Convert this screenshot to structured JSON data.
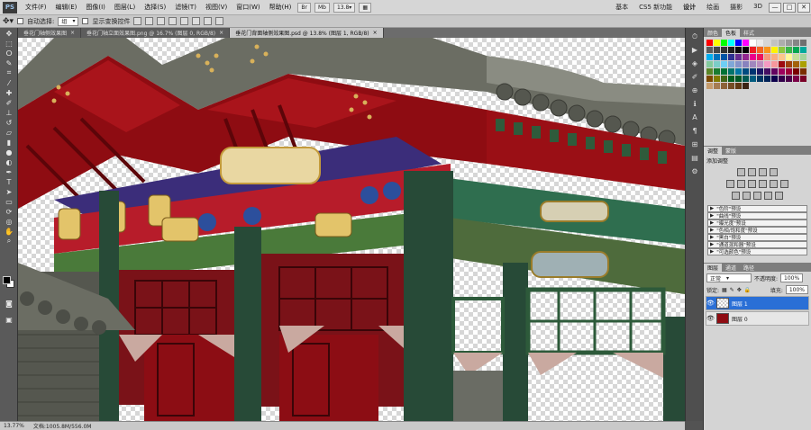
{
  "app": {
    "logo": "PS",
    "menus": [
      "文件(F)",
      "编辑(E)",
      "图像(I)",
      "图层(L)",
      "选择(S)",
      "滤镜(T)",
      "视图(V)",
      "窗口(W)",
      "帮助(H)"
    ],
    "zoom_select": "13.8",
    "workspaces": [
      "基本",
      "CS5 新功能",
      "设计",
      "绘画",
      "摄影",
      "3D"
    ],
    "active_workspace": "设计",
    "window_buttons": [
      "—",
      "□",
      "✕"
    ]
  },
  "options": {
    "auto_select_label": "自动选择:",
    "auto_select_value": "组",
    "show_transform_label": "显示变换控件"
  },
  "tabs": [
    {
      "label": "垂花门轴侧效果图",
      "close": "×"
    },
    {
      "label": "垂花门轴立面效果图.png @ 16.7% (图层 0, RGB/8)",
      "close": "×"
    },
    {
      "label": "垂花门背面轴侧效果图.psd @ 13.8% (图层 1, RGB/8)",
      "close": "×",
      "active": true
    }
  ],
  "status": {
    "zoom": "13.77%",
    "doc": "文档:1005.8M/556.0M"
  },
  "panels": {
    "swatches_tabs": [
      "颜色",
      "色板",
      "样式"
    ],
    "adjust_tabs": [
      "调整",
      "蒙版"
    ],
    "adjust_title": "添加调整",
    "presets": [
      "\"色阶\"预设",
      "\"曲线\"预设",
      "\"曝光度\"预设",
      "\"色相/饱和度\"预设",
      "\"黑白\"预设",
      "\"通道混和器\"预设",
      "\"可选颜色\"预设"
    ],
    "layers_tabs": [
      "图层",
      "通道",
      "路径"
    ],
    "blend_mode": "正常",
    "opacity_label": "不透明度:",
    "opacity_value": "100%",
    "lock_label": "锁定:",
    "fill_label": "填充:",
    "fill_value": "100%",
    "layers": [
      {
        "name": "图层 1",
        "active": true
      },
      {
        "name": "图层 0",
        "active": false
      }
    ]
  },
  "colors": {
    "swatches": [
      "#ff0000",
      "#ffff00",
      "#00ff00",
      "#00ffff",
      "#0000ff",
      "#ff00ff",
      "#ffffff",
      "#ebebeb",
      "#d6d6d6",
      "#c2c2c2",
      "#adadad",
      "#999999",
      "#858585",
      "#707070",
      "#5c5c5c",
      "#474747",
      "#333333",
      "#1f1f1f",
      "#0a0a0a",
      "#000000",
      "#ed1c24",
      "#f26522",
      "#f7941d",
      "#fff200",
      "#8dc63f",
      "#39b54a",
      "#00a651",
      "#00a99d",
      "#00aeef",
      "#0072bc",
      "#0054a6",
      "#2e3192",
      "#662d91",
      "#92278f",
      "#ec008c",
      "#ed145b",
      "#f7977a",
      "#f9ad81",
      "#fdc68a",
      "#fff79a",
      "#c4df9b",
      "#a3d39c",
      "#82ca9d",
      "#7bcdc8",
      "#6ecff6",
      "#7ea7d8",
      "#8493ca",
      "#8882be",
      "#a187be",
      "#bc8dbf",
      "#f49ac2",
      "#f6989d",
      "#9e0b0f",
      "#a0410d",
      "#a3620a",
      "#aba000",
      "#598527",
      "#1a7b30",
      "#007236",
      "#00746b",
      "#0076a3",
      "#004b80",
      "#003471",
      "#1b1464",
      "#440e62",
      "#630460",
      "#9e005d",
      "#9e0039",
      "#790000",
      "#7b2e00",
      "#7d4900",
      "#827b00",
      "#406618",
      "#005e20",
      "#005826",
      "#005952",
      "#005b7f",
      "#003663",
      "#002157",
      "#0d004c",
      "#32004b",
      "#4b0049",
      "#7b0046",
      "#7a0026",
      "#c69c6d",
      "#a67c52",
      "#8c6239",
      "#754c24",
      "#603913",
      "#3c2415"
    ]
  }
}
